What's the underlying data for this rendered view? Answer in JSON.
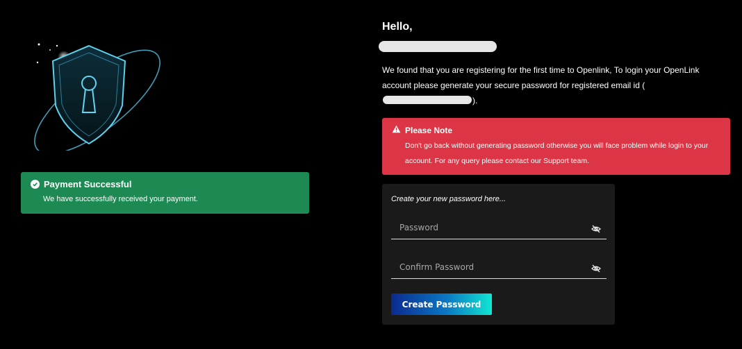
{
  "icons": {
    "shield": "shield-lock-icon",
    "check": "check-circle-icon",
    "warning": "warning-triangle-icon",
    "eye": "eye-slash-icon"
  },
  "success": {
    "title": "Payment Successful",
    "text": "We have successfully received your payment."
  },
  "greeting": "Hello,",
  "intro": {
    "part1": "We found that you are registering for the first time to Openlink, To login your OpenLink account please generate your secure password for registered email id (",
    "part2": ")."
  },
  "warning": {
    "title": "Please Note",
    "text": "Don't go back without generating password otherwise you will face problem while login to your account. For any query please contact our Support team."
  },
  "form": {
    "title": "Create your new password here...",
    "password_placeholder": "Password",
    "confirm_placeholder": "Confirm Password",
    "submit_label": "Create Password"
  },
  "colors": {
    "success": "#1e8a53",
    "warning": "#dc3545",
    "card": "#1a1a1a",
    "button_start": "#0b2a8f",
    "button_end": "#11e6d2"
  }
}
